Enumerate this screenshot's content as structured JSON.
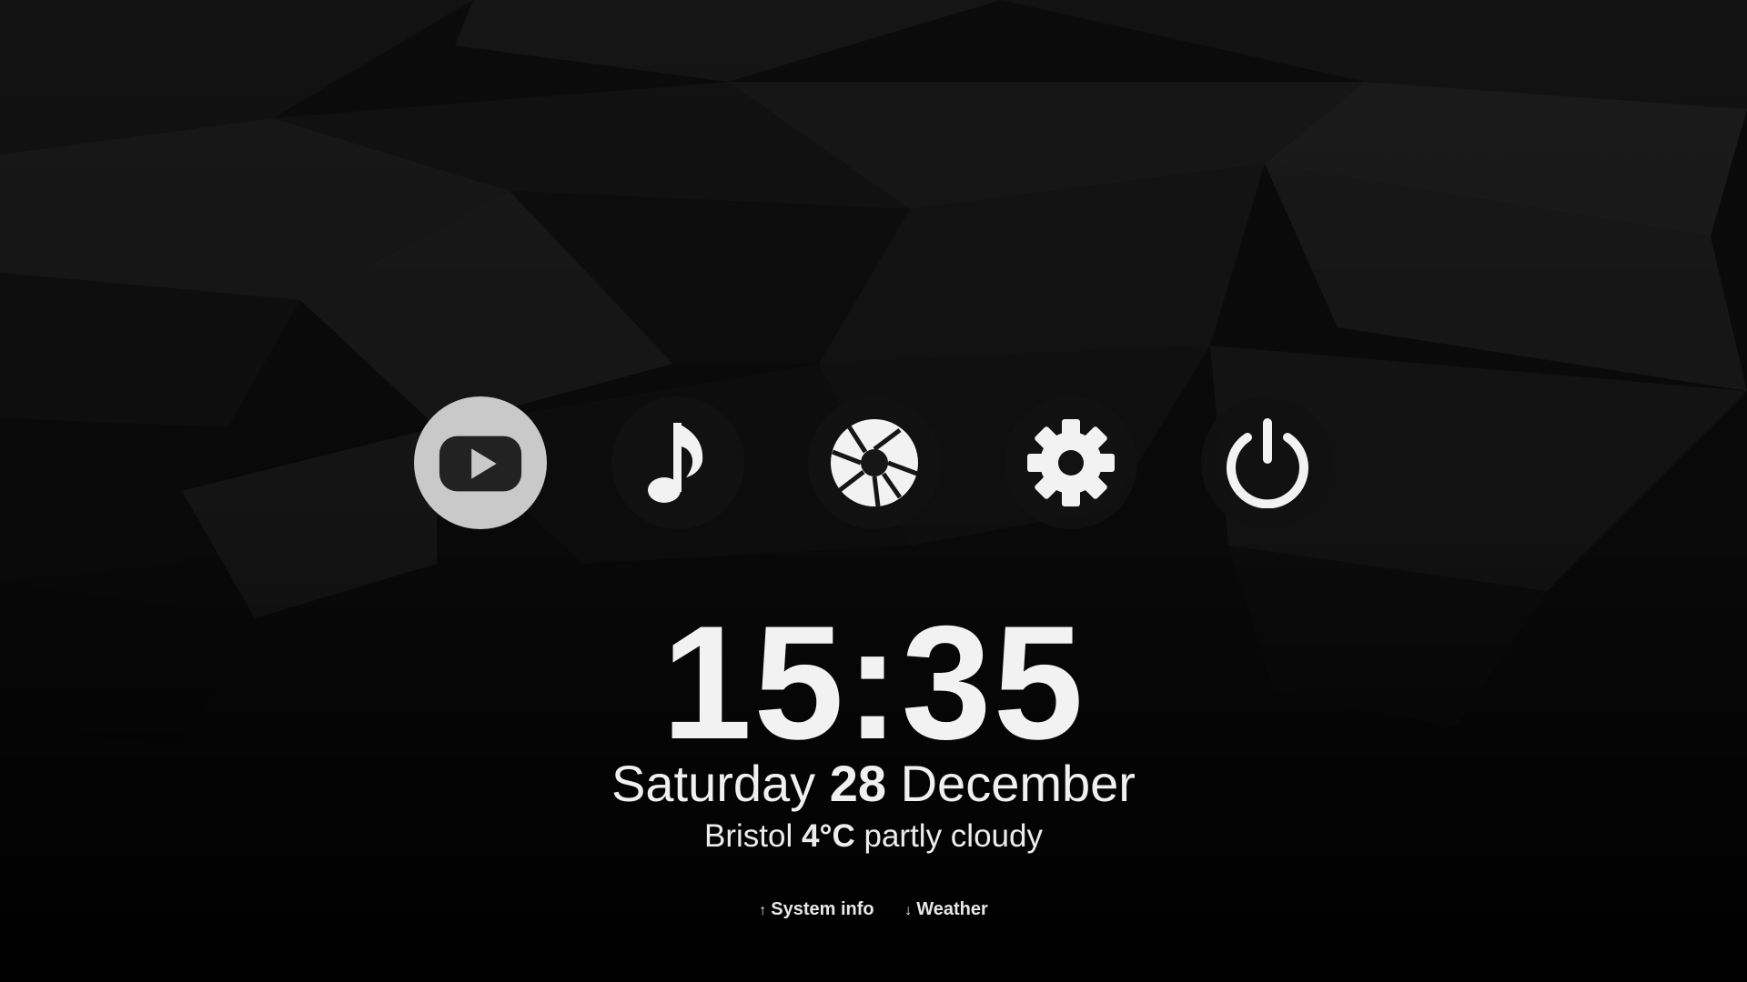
{
  "menu": {
    "items": [
      {
        "id": "youtube",
        "icon": "youtube-play-icon",
        "selected": true
      },
      {
        "id": "music",
        "icon": "music-note-icon",
        "selected": false
      },
      {
        "id": "photos",
        "icon": "camera-aperture-icon",
        "selected": false
      },
      {
        "id": "settings",
        "icon": "gear-icon",
        "selected": false
      },
      {
        "id": "power",
        "icon": "power-icon",
        "selected": false
      }
    ]
  },
  "clock": {
    "time": "15:35"
  },
  "date": {
    "weekday": "Saturday",
    "day": "28",
    "month": "December"
  },
  "weather": {
    "location": "Bristol",
    "temperature": "4°C",
    "condition": "partly cloudy"
  },
  "hints": {
    "up_arrow": "↑",
    "up_label": "System info",
    "down_arrow": "↓",
    "down_label": "Weather"
  },
  "colors": {
    "background": "#000000",
    "selected_button": "#c9c9c9",
    "icon": "#f2f2f2",
    "text": "#f0f0f0"
  }
}
